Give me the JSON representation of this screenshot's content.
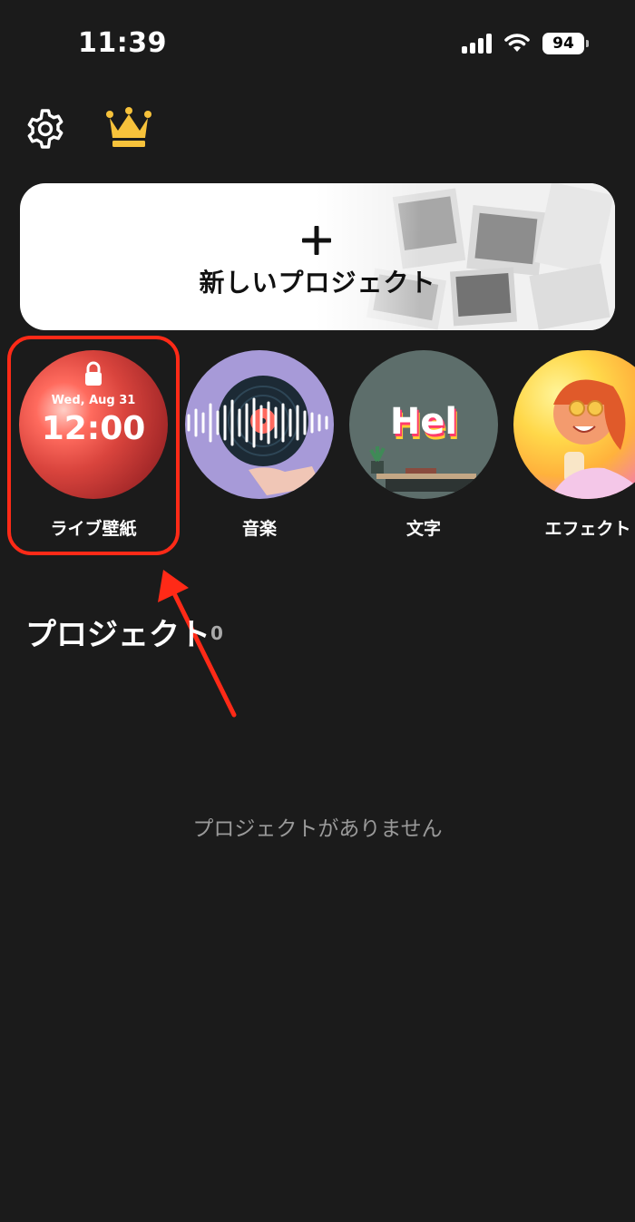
{
  "status_bar": {
    "time": "11:39",
    "battery": "94"
  },
  "top_bar": {
    "settings_icon": "gear-icon",
    "premium_icon": "crown-icon"
  },
  "new_project": {
    "plus": "+",
    "label": "新しいプロジェクト"
  },
  "categories": [
    {
      "label": "ライブ壁紙",
      "date": "Wed, Aug 31",
      "time": "12:00"
    },
    {
      "label": "音楽"
    },
    {
      "label": "文字",
      "preview_text": "Hel"
    },
    {
      "label": "エフェクト"
    }
  ],
  "projects": {
    "title": "プロジェクト",
    "count": "0",
    "empty_message": "プロジェクトがありません"
  },
  "colors": {
    "background": "#1b1b1b",
    "highlight": "#ff2a17",
    "crown": "#f7c23b"
  }
}
